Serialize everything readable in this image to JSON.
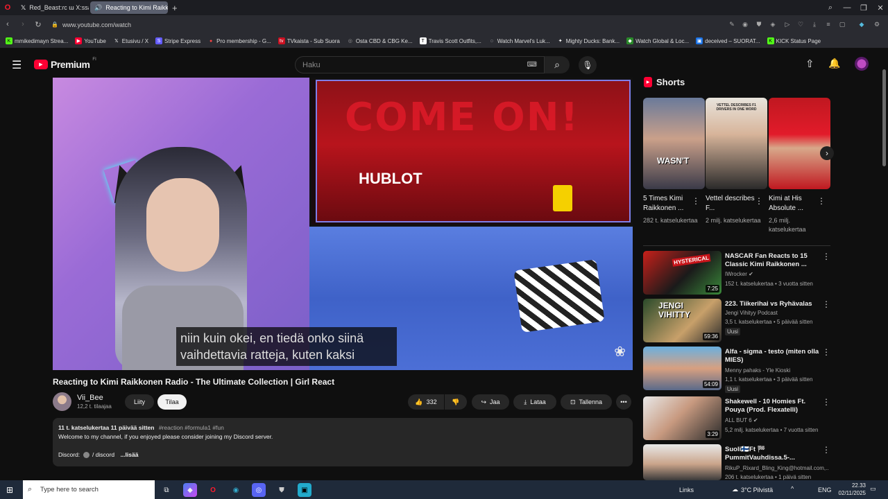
{
  "browser": {
    "tabs": [
      {
        "label": "Red_Beast:ɾᴄ ɯ X:ssä: \"Mi"
      },
      {
        "label": "Reacting to Kimi Raikk"
      }
    ],
    "url": "www.youtube.com/watch",
    "bookmarks": [
      "mmikedimayn Strea...",
      "YouTube",
      "Etusivu / X",
      "Stripe Express",
      "Pro membership - G...",
      "TVkaista - Sub Suora",
      "Osta CBD & CBG Ke...",
      "Travis Scott Outfits,...",
      "Watch Marvel's Luk...",
      "Mighty Ducks: Bank...",
      "Watch Global & Loc...",
      "deceived – SUORAT...",
      "KICK Status Page"
    ]
  },
  "header": {
    "logo_text": "Premium",
    "logo_region": "FI",
    "search_placeholder": "Haku"
  },
  "video": {
    "subtitle_line1": "niin kuin okei, en tiedä onko siinä",
    "subtitle_line2": "vaihdettavia ratteja, kuten kaksi",
    "overlay_text": "COME ON!",
    "brand_text": "HUBLOT",
    "title": "Reacting to Kimi Raikkonen Radio - The Ultimate Collection | Girl React",
    "channel": "Vii_Bee",
    "subscribers": "12,2 t. tilaajaa",
    "join_label": "Liity",
    "subscribe_label": "Tilaa",
    "likes": "332",
    "share_label": "Jaa",
    "download_label": "Lataa",
    "save_label": "Tallenna"
  },
  "description": {
    "meta": "11 t. katselukertaa  11 päivää sitten",
    "tags": "#reaction #formula1 #fun",
    "line1": "Welcome to my channel, if you enjoyed please consider joining my Discord server.",
    "discord_label": "Discord:",
    "discord_link": "/ discord",
    "more": "...lisää"
  },
  "shorts": {
    "title": "Shorts",
    "items": [
      {
        "title": "5 Times Kimi Raikkonen ...",
        "views": "282 t. katselukertaa",
        "overlay": "WASN'T"
      },
      {
        "title": "Vettel describes F...",
        "views": "2 milj. katselukertaa",
        "overlay": "VETTEL DESCRIBES F1 DRIVERS IN ONE WORD"
      },
      {
        "title": "Kimi at His Absolute ...",
        "views": "2,6 milj. katselukertaa",
        "overlay": ""
      }
    ]
  },
  "recommendations": [
    {
      "title": "NASCAR Fan Reacts to 15 Classic Kimi Raikkonen ...",
      "channel": "IWrocker",
      "meta": "152 t. katselukertaa • 3 vuotta sitten",
      "duration": "7:25",
      "badge": "",
      "thumb_text": "HYSTERICAL"
    },
    {
      "title": "223. Tiikerihai vs Ryhävalas",
      "channel": "Jengi Vihityy Podcast",
      "meta": "3,5 t. katselukertaa • 5 päivää sitten",
      "duration": "59:36",
      "badge": "Uusi",
      "thumb_text": "JENGI VIHITTY"
    },
    {
      "title": "Alfa - sigma - testo (miten olla MIES)",
      "channel": "Menny pahaks - Yle Kioski",
      "meta": "1,1 t. katselukertaa • 3 päivää sitten",
      "duration": "54:09",
      "badge": "Uusi",
      "thumb_text": ""
    },
    {
      "title": "Shakewell - 10 Homies Ft. Pouya (Prod. Flexatelli)",
      "channel": "ALL BUT 6",
      "meta": "5,2 milj. katselukertaa • 7 vuotta sitten",
      "duration": "3:29",
      "badge": "",
      "thumb_text": ""
    },
    {
      "title": "Suoli🇫🇮Ft 🏁PummitVauhdissa.5-...",
      "channel": "RikuP_Rixard_Bling_King@hotmail.com,...",
      "meta": "206 t. katselukertaa • 1 päivä sitten",
      "duration": "",
      "badge": "",
      "thumb_text": ""
    }
  ],
  "taskbar": {
    "search_placeholder": "Type here to search",
    "links_label": "Links",
    "weather": "3°C  Pilvistä",
    "lang": "ENG",
    "time": "22.33",
    "date": "02/11/2025"
  },
  "colors": {
    "yt_red": "#ff0033",
    "background": "#0f0f0f",
    "chip_bg": "#272727"
  }
}
